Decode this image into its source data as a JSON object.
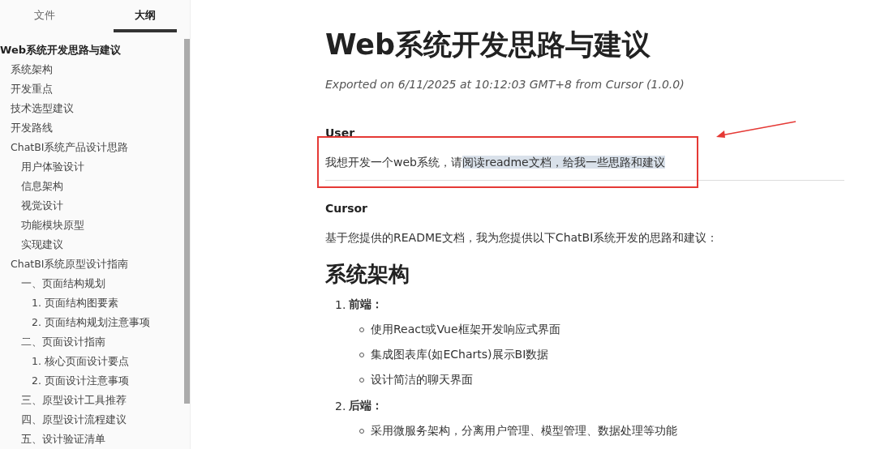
{
  "sidebar": {
    "tabs": [
      {
        "label": "文件",
        "selected": false
      },
      {
        "label": "大纲",
        "selected": true
      }
    ],
    "outline": [
      {
        "label": "Web系统开发思路与建议",
        "children": [
          {
            "label": "系统架构"
          },
          {
            "label": "开发重点"
          },
          {
            "label": "技术选型建议"
          },
          {
            "label": "开发路线"
          },
          {
            "label": "ChatBI系统产品设计思路",
            "children": [
              {
                "label": "用户体验设计"
              },
              {
                "label": "信息架构"
              },
              {
                "label": "视觉设计"
              },
              {
                "label": "功能模块原型"
              },
              {
                "label": "实现建议"
              }
            ]
          },
          {
            "label": "ChatBI系统原型设计指南",
            "children": [
              {
                "label": "一、页面结构规划",
                "children": [
                  {
                    "label": "1. 页面结构图要素"
                  },
                  {
                    "label": "2. 页面结构规划注意事项"
                  }
                ]
              },
              {
                "label": "二、页面设计指南",
                "children": [
                  {
                    "label": "1. 核心页面设计要点"
                  },
                  {
                    "label": "2. 页面设计注意事项"
                  }
                ]
              },
              {
                "label": "三、原型设计工具推荐"
              },
              {
                "label": "四、原型设计流程建议"
              },
              {
                "label": "五、设计验证清单"
              }
            ]
          }
        ]
      }
    ]
  },
  "document": {
    "title": "Web系统开发思路与建议",
    "exported": "Exported on 6/11/2025 at 10:12:03 GMT+8 from Cursor (1.0.0)",
    "user_label": "User",
    "user_message": {
      "plain": "我想开发一个web系统，请",
      "highlighted": "阅读readme文档，给我一些思路和建议"
    },
    "cursor_label": "Cursor",
    "intro": "基于您提供的README文档，我为您提供以下ChatBI系统开发的思路和建议：",
    "heading": "系统架构",
    "list": [
      {
        "number": "1.",
        "label": "前端：",
        "items": [
          "使用React或Vue框架开发响应式界面",
          "集成图表库(如ECharts)展示BI数据",
          "设计简洁的聊天界面"
        ]
      },
      {
        "number": "2.",
        "label": "后端：",
        "items": [
          "采用微服务架构，分离用户管理、模型管理、数据处理等功能"
        ]
      }
    ]
  }
}
